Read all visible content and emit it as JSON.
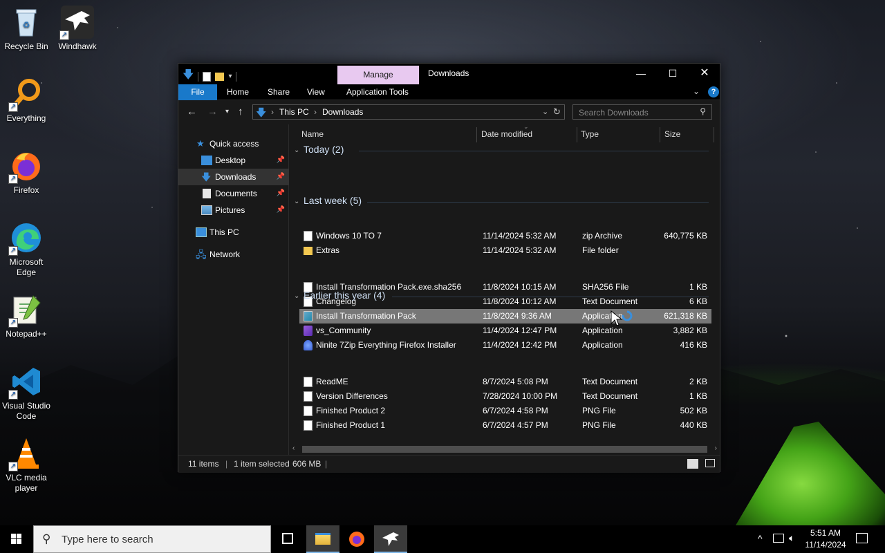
{
  "desktop": {
    "icons": [
      {
        "label": "Recycle Bin"
      },
      {
        "label": "Windhawk"
      },
      {
        "label": "Everything"
      },
      {
        "label": "Firefox"
      },
      {
        "label": "Microsoft Edge"
      },
      {
        "label": "Notepad++"
      },
      {
        "label": "Visual Studio Code"
      },
      {
        "label": "VLC media player"
      }
    ]
  },
  "window": {
    "title": "Downloads",
    "manage_tab": "Manage",
    "ribbon_tabs": [
      "File",
      "Home",
      "Share",
      "View",
      "Application Tools"
    ],
    "address": {
      "crumbs": [
        "This PC",
        "Downloads"
      ]
    },
    "search_placeholder": "Search Downloads",
    "nav": {
      "quick_access": "Quick access",
      "items": [
        "Desktop",
        "Downloads",
        "Documents",
        "Pictures"
      ],
      "this_pc": "This PC",
      "network": "Network"
    },
    "columns": {
      "name": "Name",
      "date": "Date modified",
      "type": "Type",
      "size": "Size"
    },
    "groups": [
      {
        "title": "Today (2)",
        "rows": [
          {
            "name": "Windows 10 TO 7",
            "date": "11/14/2024 5:32 AM",
            "type": "zip Archive",
            "size": "640,775 KB",
            "icon": "zip-icon"
          },
          {
            "name": "Extras",
            "date": "11/14/2024 5:32 AM",
            "type": "File folder",
            "size": "",
            "icon": "folder-icon"
          }
        ]
      },
      {
        "title": "Last week (5)",
        "rows": [
          {
            "name": "Install Transformation Pack.exe.sha256",
            "date": "11/8/2024 10:15 AM",
            "type": "SHA256 File",
            "size": "1 KB",
            "icon": "file-icon"
          },
          {
            "name": "Changelog",
            "date": "11/8/2024 10:12 AM",
            "type": "Text Document",
            "size": "6 KB",
            "icon": "text-file-icon"
          },
          {
            "name": "Install Transformation Pack",
            "date": "11/8/2024 9:36 AM",
            "type": "Application",
            "size": "621,318 KB",
            "icon": "installer-icon"
          },
          {
            "name": "vs_Community",
            "date": "11/4/2024 12:47 PM",
            "type": "Application",
            "size": "3,882 KB",
            "icon": "visual-studio-icon"
          },
          {
            "name": "Ninite 7Zip Everything Firefox Installer",
            "date": "11/4/2024 12:42 PM",
            "type": "Application",
            "size": "416 KB",
            "icon": "ninite-icon"
          }
        ]
      },
      {
        "title": "Earlier this year (4)",
        "rows": [
          {
            "name": "ReadME",
            "date": "8/7/2024 5:08 PM",
            "type": "Text Document",
            "size": "2 KB",
            "icon": "text-file-icon"
          },
          {
            "name": "Version Differences",
            "date": "7/28/2024 10:00 PM",
            "type": "Text Document",
            "size": "1 KB",
            "icon": "text-file-icon"
          },
          {
            "name": "Finished Product 2",
            "date": "6/7/2024 4:58 PM",
            "type": "PNG File",
            "size": "502 KB",
            "icon": "image-file-icon"
          },
          {
            "name": "Finished Product 1",
            "date": "6/7/2024 4:57 PM",
            "type": "PNG File",
            "size": "440 KB",
            "icon": "image-file-icon"
          }
        ]
      }
    ],
    "selected_row": "Install Transformation Pack",
    "status": {
      "items": "11 items",
      "selected": "1 item selected",
      "size": "606 MB"
    }
  },
  "taskbar": {
    "search_placeholder": "Type here to search",
    "time": "5:51 AM",
    "date": "11/14/2024"
  },
  "colors": {
    "accent": "#1979ca",
    "manage_tab": "#e8c9f0",
    "selection": "#777777"
  }
}
